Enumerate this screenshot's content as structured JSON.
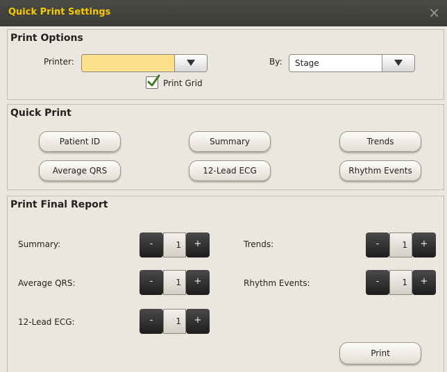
{
  "window": {
    "title": "Quick Print Settings",
    "close_glyph": "×"
  },
  "print_options": {
    "title": "Print Options",
    "printer_label": "Printer:",
    "printer_value": "",
    "by_label": "By:",
    "by_value": "Stage",
    "print_grid_label": "Print Grid",
    "print_grid_checked": true,
    "printer_highlight_color": "#fde08a"
  },
  "quick_print": {
    "title": "Quick Print",
    "buttons": [
      "Patient ID",
      "Summary",
      "Trends",
      "Average QRS",
      "12-Lead ECG",
      "Rhythm Events"
    ]
  },
  "final_report": {
    "title": "Print Final Report",
    "rows": [
      {
        "label": "Summary:",
        "value": "1"
      },
      {
        "label": "Trends:",
        "value": "1"
      },
      {
        "label": "Average QRS:",
        "value": "1"
      },
      {
        "label": "Rhythm Events:",
        "value": "1"
      },
      {
        "label": "12-Lead ECG:",
        "value": "1"
      }
    ],
    "minus_glyph": "-",
    "plus_glyph": "+",
    "print_label": "Print"
  }
}
